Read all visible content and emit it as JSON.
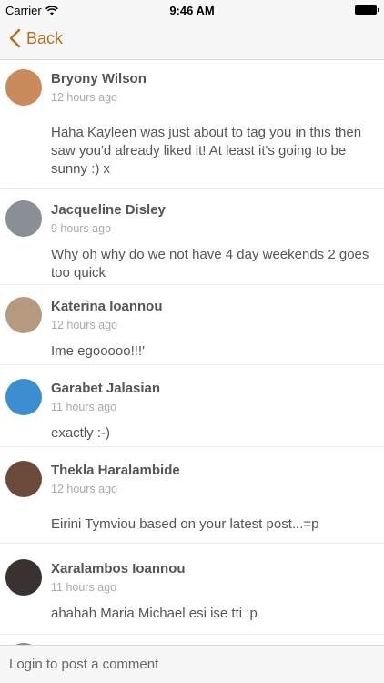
{
  "status_bar": {
    "carrier": "Carrier",
    "time": "9:46 AM"
  },
  "nav": {
    "back_label": "Back"
  },
  "comments": [
    {
      "name": "Bryony Wilson",
      "time": "12 hours ago",
      "text": "Haha Kayleen was just about to tag you in this then saw you'd already liked it! At least it's going to be sunny :) x",
      "avatar_color": "#c98b5a"
    },
    {
      "name": "Jacqueline Disley",
      "time": "9 hours ago",
      "text": "Why oh why do we not have 4 day weekends 2 goes too quick",
      "avatar_color": "#8a8f96"
    },
    {
      "name": "Katerina Ioannou",
      "time": "12 hours ago",
      "text": "Ime egooooo!!!'",
      "avatar_color": "#b59a80"
    },
    {
      "name": "Garabet Jalasian",
      "time": "11 hours ago",
      "text": "exactly :-)",
      "avatar_color": "#3b8fd0"
    },
    {
      "name": "Thekla Haralambide",
      "time": "12 hours ago",
      "text": "Eirini Tymviou based on your latest post...=p",
      "avatar_color": "#6b4a3a"
    },
    {
      "name": "Xaralambos Ioannou",
      "time": "11 hours ago",
      "text": "ahahah Maria Michael esi ise tti :p",
      "avatar_color": "#3a3230"
    }
  ],
  "footer": {
    "placeholder": "Login to post a comment"
  },
  "colors": {
    "accent": "#b5701f"
  }
}
